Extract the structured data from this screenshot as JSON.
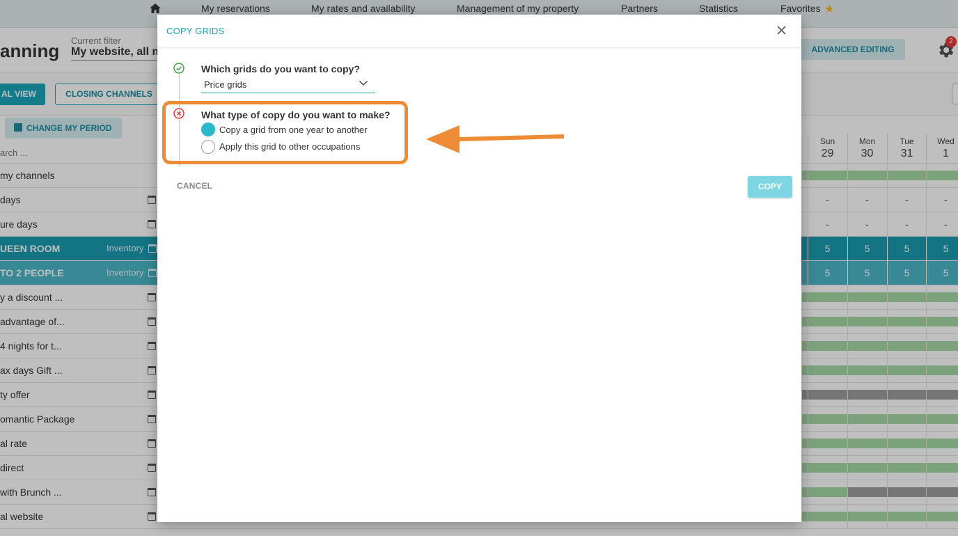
{
  "topnav": {
    "items": [
      "My reservations",
      "My rates and availability",
      "Management of my property",
      "Partners",
      "Statistics",
      "Favorites"
    ]
  },
  "header": {
    "page_title": "anning",
    "filter_label": "Current filter",
    "filter_value": "My website, all m",
    "advanced_editing": "ADVANCED EDITING",
    "notification_count": "2"
  },
  "toolbar": {
    "view_button": "AL VIEW",
    "closing_channels": "CLOSING CHANNELS",
    "change_period": "CHANGE MY PERIOD",
    "search_stub": "arch ..."
  },
  "days": [
    {
      "name": "Sun",
      "date": "29"
    },
    {
      "name": "Mon",
      "date": "30"
    },
    {
      "name": "Tue",
      "date": "31"
    },
    {
      "name": "Wed",
      "date": "1"
    }
  ],
  "rows": [
    {
      "label": "my channels",
      "type": "plain",
      "cells": [
        "",
        "",
        "",
        ""
      ],
      "bar": "green"
    },
    {
      "label": "days",
      "type": "cal",
      "cells": [
        "-",
        "-",
        "-",
        "-"
      ]
    },
    {
      "label": "ure days",
      "type": "cal",
      "cells": [
        "-",
        "-",
        "-",
        "-"
      ]
    },
    {
      "label": "UEEN ROOM",
      "type": "teal",
      "inventory": "Inventory",
      "cells": [
        "5",
        "5",
        "5",
        "5"
      ]
    },
    {
      "label": "TO 2 PEOPLE",
      "type": "teal2",
      "inventory": "Inventory",
      "cells": [
        "5",
        "5",
        "5",
        "5"
      ]
    },
    {
      "label": "y a discount ...",
      "type": "cal",
      "cells": [
        "",
        "",
        "",
        ""
      ],
      "bar": "green"
    },
    {
      "label": "advantage of...",
      "type": "cal",
      "cells": [
        "",
        "",
        "",
        ""
      ],
      "bar": "green"
    },
    {
      "label": "4 nights for t...",
      "type": "cal",
      "cells": [
        "",
        "",
        "",
        ""
      ],
      "bar": "green"
    },
    {
      "label": "ax days Gift ...",
      "type": "cal",
      "cells": [
        "",
        "",
        "",
        ""
      ],
      "bar": "green"
    },
    {
      "label": "ty offer",
      "type": "cal",
      "cells": [
        "",
        "",
        "",
        ""
      ],
      "bar": "grey"
    },
    {
      "label": "omantic Package",
      "type": "cal",
      "cells": [
        "",
        "",
        "",
        ""
      ],
      "bar": "green"
    },
    {
      "label": "al rate",
      "type": "cal",
      "cells": [
        "",
        "",
        "",
        ""
      ],
      "bar": "green"
    },
    {
      "label": " direct",
      "type": "cal",
      "cells": [
        "",
        "",
        "",
        ""
      ],
      "bar": "green"
    },
    {
      "label": " with Brunch ...",
      "type": "cal",
      "cells": [
        "",
        "",
        "",
        ""
      ],
      "bar": "mixed"
    },
    {
      "label": "al website",
      "type": "cal",
      "cells": [
        "",
        "",
        "",
        ""
      ],
      "bar": "green"
    }
  ],
  "modal": {
    "title": "COPY GRIDS",
    "step1": {
      "question": "Which grids do you want to copy?",
      "selected": "Price grids",
      "status": "done"
    },
    "step2": {
      "question": "What type of copy do you want to make?",
      "status": "error",
      "options": [
        {
          "label": "Copy a grid from one year to another",
          "selected": true
        },
        {
          "label": "Apply this grid to other occupations",
          "selected": false
        }
      ]
    },
    "cancel_label": "CANCEL",
    "copy_label": "COPY"
  },
  "colors": {
    "accent": "#1aa4b8",
    "annotation": "#ee8b35",
    "error": "#e53935",
    "success": "#43a047"
  },
  "icons": [
    "home-icon",
    "star-icon",
    "gear-icon",
    "close-icon",
    "check-circle-icon",
    "error-circle-icon",
    "chevron-down-icon",
    "calendar-icon"
  ]
}
